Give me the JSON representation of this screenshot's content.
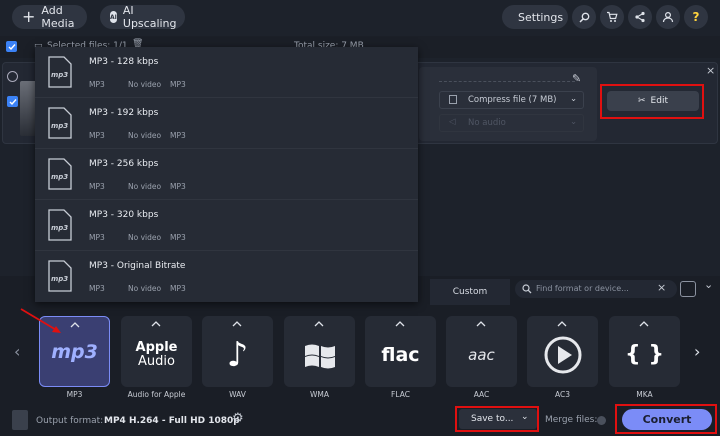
{
  "toolbar": {
    "add_media": "Add Media",
    "ai_upscaling": "AI Upscaling",
    "settings": "Settings"
  },
  "filebar": {
    "selected_files": "Selected files: 1/1",
    "total_size": "Total size: 7 MB"
  },
  "file": {
    "compress": "Compress file (7 MB)",
    "audio": "No audio",
    "edit": "Edit"
  },
  "dropdown": {
    "items": [
      {
        "name": "MP3 - 128 kbps",
        "format": "MP3",
        "video": "No video",
        "audio": "MP3"
      },
      {
        "name": "MP3 - 192 kbps",
        "format": "MP3",
        "video": "No video",
        "audio": "MP3"
      },
      {
        "name": "MP3 - 256 kbps",
        "format": "MP3",
        "video": "No video",
        "audio": "MP3"
      },
      {
        "name": "MP3 - 320 kbps",
        "format": "MP3",
        "video": "No video",
        "audio": "MP3"
      },
      {
        "name": "MP3 - Original Bitrate",
        "format": "MP3",
        "video": "No video",
        "audio": "MP3"
      }
    ]
  },
  "formats": {
    "custom_tab": "Custom",
    "search_placeholder": "Find format or device...",
    "tiles": [
      {
        "label": "MP3",
        "icon": "mp3-icon",
        "text": "mp3"
      },
      {
        "label": "Audio for Apple",
        "icon": "apple-audio-icon",
        "text1": "Apple",
        "text2": "Audio"
      },
      {
        "label": "WAV",
        "icon": "music-note-icon"
      },
      {
        "label": "WMA",
        "icon": "windows-icon"
      },
      {
        "label": "FLAC",
        "icon": "flac-icon",
        "text": "flac"
      },
      {
        "label": "AAC",
        "icon": "aac-icon",
        "text": "aac"
      },
      {
        "label": "AC3",
        "icon": "ac3-icon"
      },
      {
        "label": "MKA",
        "icon": "mka-icon",
        "text": "{ }"
      }
    ]
  },
  "footer": {
    "output_label": "Output format:",
    "output_value": "MP4 H.264 - Full HD 1080p",
    "save_to": "Save to...",
    "merge": "Merge files:",
    "convert": "Convert"
  },
  "colors": {
    "accent": "#7b8cf7",
    "highlight": "#e01010"
  }
}
